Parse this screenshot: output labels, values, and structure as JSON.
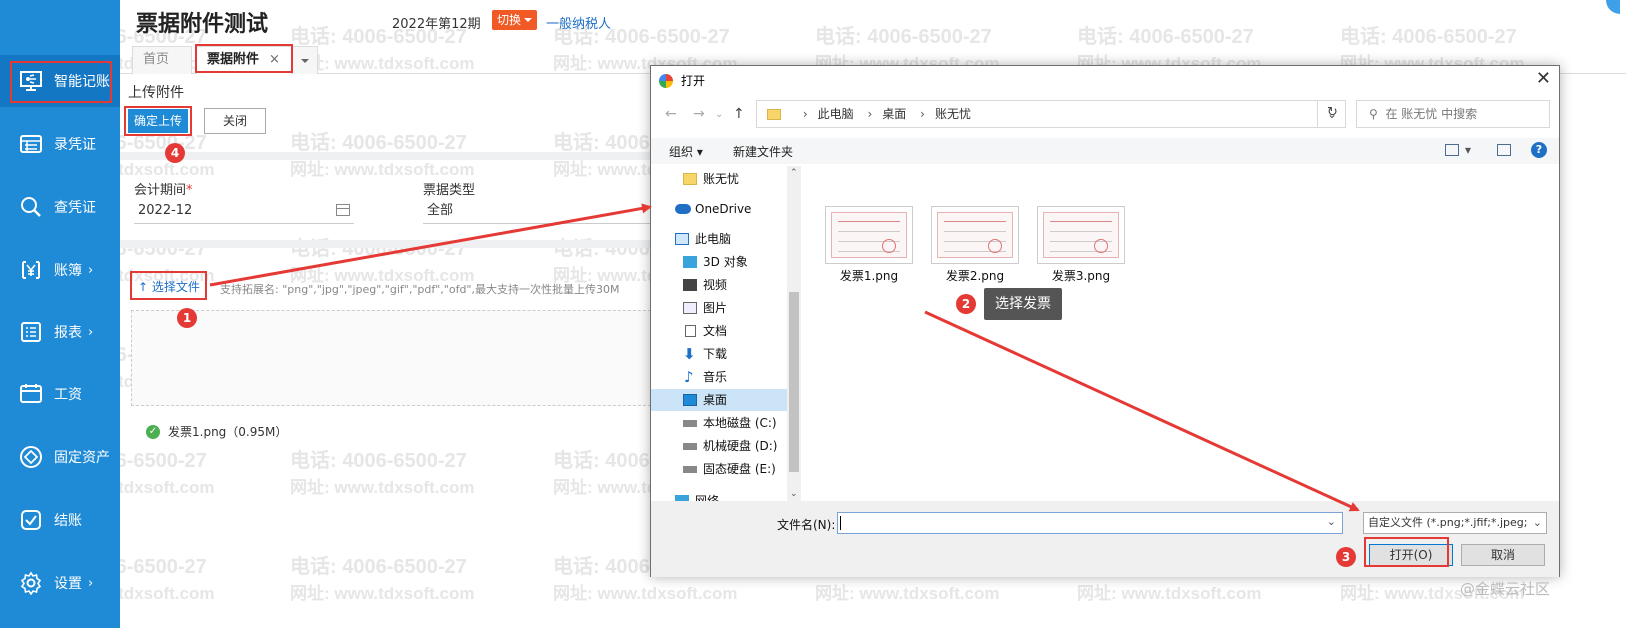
{
  "app": {
    "title": "票据附件测试",
    "period": "2022年第12期",
    "switch_label": "切换",
    "taxpayer_type": "一般纳税人"
  },
  "watermark": {
    "phone": "电话: 4006-6500-27",
    "site": "网址: www.tdxsoft.com"
  },
  "sidebar": {
    "items": [
      {
        "label": "智能记账",
        "icon": "smart-accounting-icon",
        "active": true
      },
      {
        "label": "录凭证",
        "icon": "voucher-entry-icon"
      },
      {
        "label": "查凭证",
        "icon": "search-icon"
      },
      {
        "label": "账簿",
        "icon": "yen-icon",
        "arrow": "›"
      },
      {
        "label": "报表",
        "icon": "report-icon",
        "arrow": "›"
      },
      {
        "label": "工资",
        "icon": "salary-icon"
      },
      {
        "label": "固定资产",
        "icon": "fixed-asset-icon"
      },
      {
        "label": "结账",
        "icon": "checkout-icon"
      },
      {
        "label": "设置",
        "icon": "gear-icon",
        "arrow": "›"
      }
    ]
  },
  "tabs": [
    {
      "label": "首页"
    },
    {
      "label": "票据附件",
      "close": "×",
      "active": true
    }
  ],
  "upload": {
    "title": "上传附件",
    "confirm_label": "确定上传",
    "close_label": "关闭",
    "period_label": "会计期间",
    "required_mark": "*",
    "period_value": "2022-12",
    "bill_type_label": "票据类型",
    "bill_type_value": "全部",
    "choose_label": "选择文件",
    "choose_icon": "↑",
    "hint": "支持拓展名: \"png\",\"jpg\",\"jpeg\",\"gif\",\"pdf\",\"ofd\",最大支持一次性批量上传30M",
    "file": {
      "name": "发票1.png",
      "size": "（0.95M）"
    }
  },
  "steps": [
    "1",
    "2",
    "3",
    "4"
  ],
  "tooltip": "选择发票",
  "dialog": {
    "title": "打开",
    "close": "✕",
    "breadcrumb": [
      "此电脑",
      "桌面",
      "账无忧"
    ],
    "search_placeholder": "在 账无忧 中搜索",
    "toolbar": {
      "organize": "组织 ▾",
      "new_folder": "新建文件夹"
    },
    "nav_items": [
      {
        "label": "账无忧",
        "icon": "folder-icon"
      },
      {
        "label": "OneDrive",
        "icon": "cloud-icon"
      },
      {
        "label": "此电脑",
        "icon": "computer-icon"
      },
      {
        "label": "3D 对象",
        "icon": "cube-icon"
      },
      {
        "label": "视频",
        "icon": "video-icon"
      },
      {
        "label": "图片",
        "icon": "picture-icon"
      },
      {
        "label": "文档",
        "icon": "document-icon"
      },
      {
        "label": "下载",
        "icon": "download-icon"
      },
      {
        "label": "音乐",
        "icon": "music-icon"
      },
      {
        "label": "桌面",
        "icon": "desktop-icon",
        "selected": true
      },
      {
        "label": "本地磁盘 (C:)",
        "icon": "drive-icon"
      },
      {
        "label": "机械硬盘 (D:)",
        "icon": "drive-icon"
      },
      {
        "label": "固态硬盘 (E:)",
        "icon": "drive-icon"
      },
      {
        "label": "网络",
        "icon": "network-icon"
      }
    ],
    "files": [
      "发票1.png",
      "发票2.png",
      "发票3.png"
    ],
    "filename_label": "文件名(N):",
    "filetype": "自定义文件 (*.png;*.jfif;*.jpeg;",
    "open_label": "打开(O)",
    "cancel_label": "取消"
  },
  "footer_brand": "@金蝶云社区"
}
